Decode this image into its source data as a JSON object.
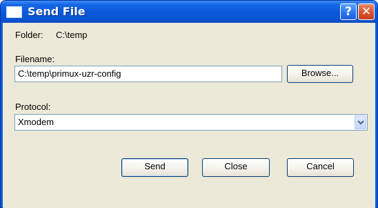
{
  "window": {
    "title": "Send File",
    "help_symbol": "?",
    "close_symbol": "✕"
  },
  "form": {
    "folder_label": "Folder:",
    "folder_value": "C:\\temp",
    "filename_label": "Filename:",
    "filename_value": "C:\\temp\\primux-uzr-config",
    "browse_label": "Browse...",
    "protocol_label": "Protocol:",
    "protocol_selected": "Xmodem"
  },
  "buttons": {
    "send": "Send",
    "close": "Close",
    "cancel": "Cancel"
  },
  "icons": {
    "window_icon": "window-icon",
    "help": "help-icon",
    "close": "close-icon",
    "dropdown": "chevron-down-icon"
  },
  "colors": {
    "titlebar": "#0a5ad9",
    "close_button": "#d9542e",
    "dialog_background": "#ece9d8"
  }
}
